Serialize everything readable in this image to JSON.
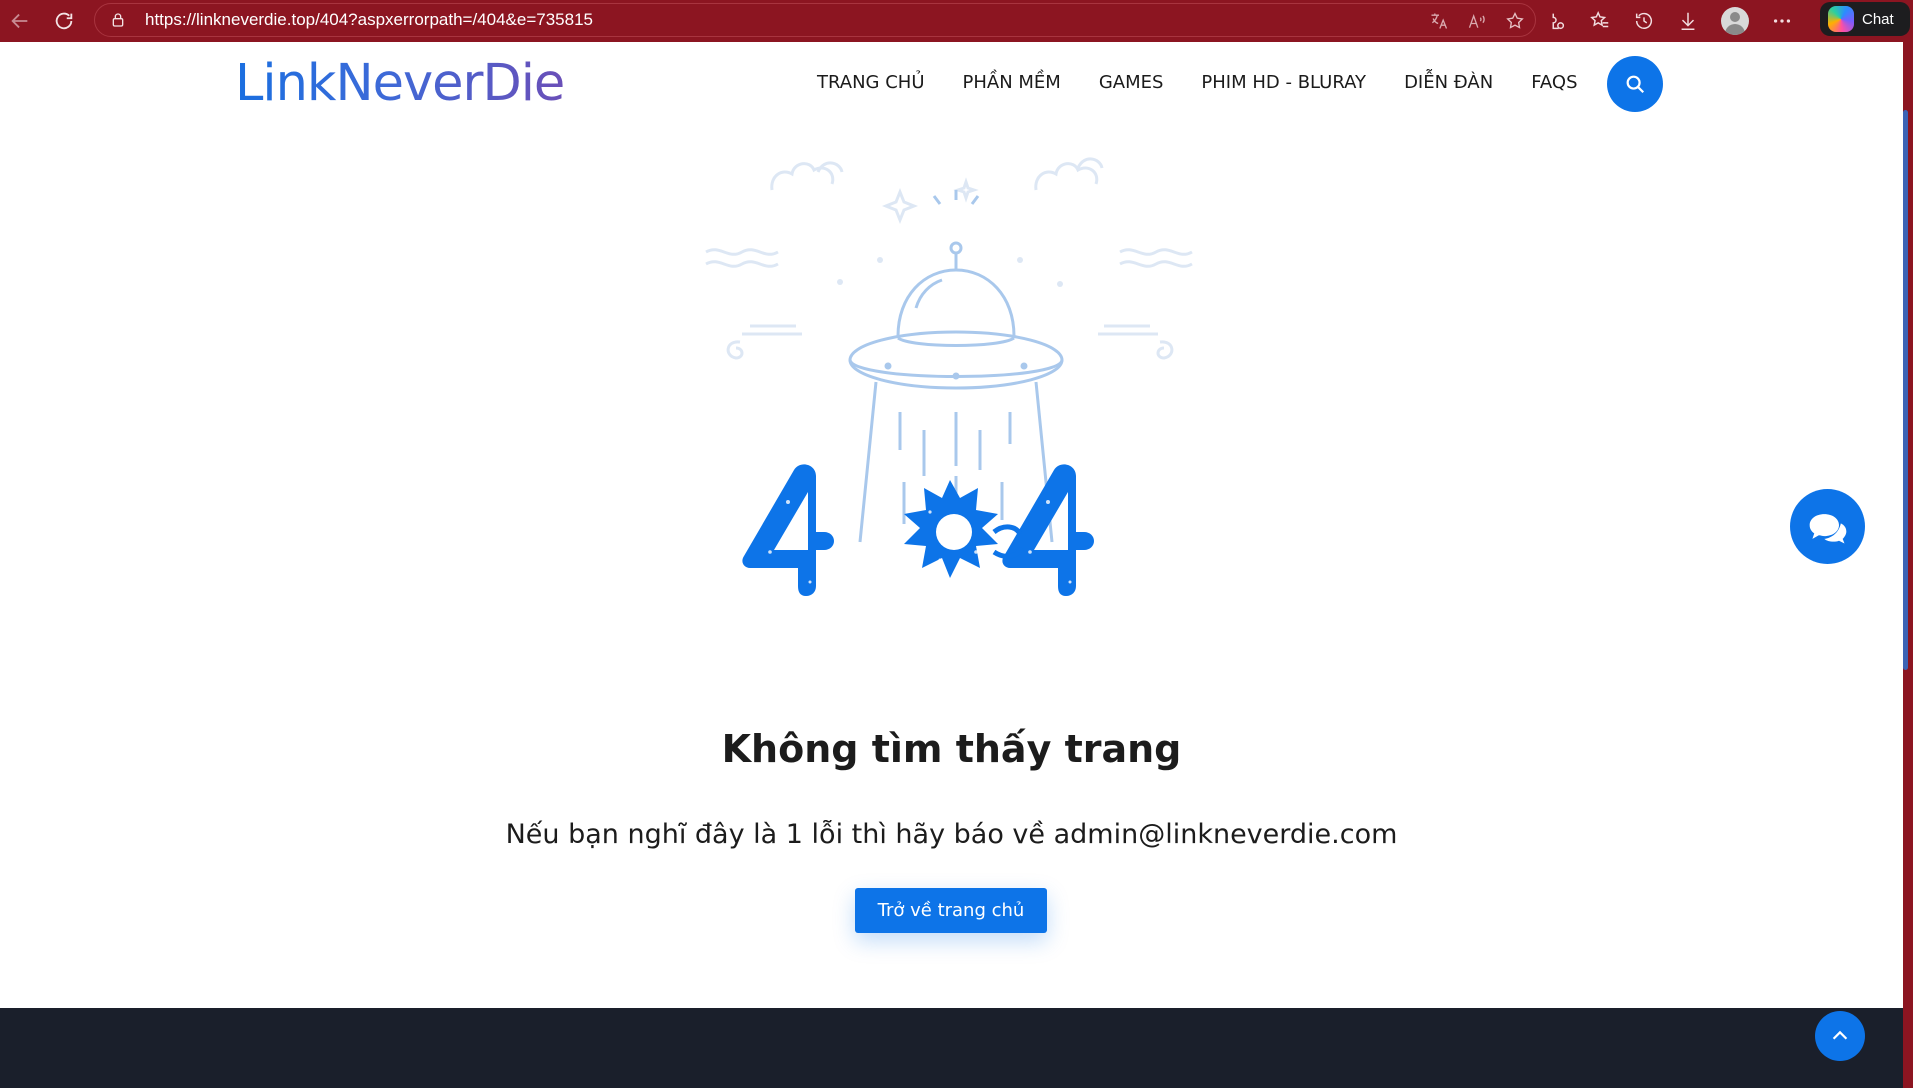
{
  "browser": {
    "url": "https://linkneverdie.top/404?aspxerrorpath=/404&e=735815",
    "chat_label": "Chat",
    "icons": [
      "back-icon",
      "refresh-icon",
      "lock-icon",
      "translate-icon",
      "read-aloud-icon",
      "favorite-star-icon",
      "extensions-icon",
      "favorites-icon",
      "history-icon",
      "download-icon",
      "profile-icon",
      "more-icon",
      "copilot-icon"
    ]
  },
  "site": {
    "logo": "LinkNeverDie",
    "nav": [
      {
        "label": "TRANG CHỦ"
      },
      {
        "label": "PHẦN MỀM"
      },
      {
        "label": "GAMES"
      },
      {
        "label": "PHIM HD - BLURAY"
      },
      {
        "label": "DIỄN ĐÀN"
      },
      {
        "label": "FAQS"
      }
    ]
  },
  "error": {
    "code": "404",
    "title": "Không tìm thấy trang",
    "message": "Nếu bạn nghĩ đây là 1 lỗi thì hãy báo về admin@linkneverdie.com",
    "button_label": "Trở về trang chủ"
  },
  "colors": {
    "browser_bar": "#8c1521",
    "accent": "#0d74e8",
    "illustration_line": "#a9c8ec",
    "footer": "#1a1f2b"
  }
}
